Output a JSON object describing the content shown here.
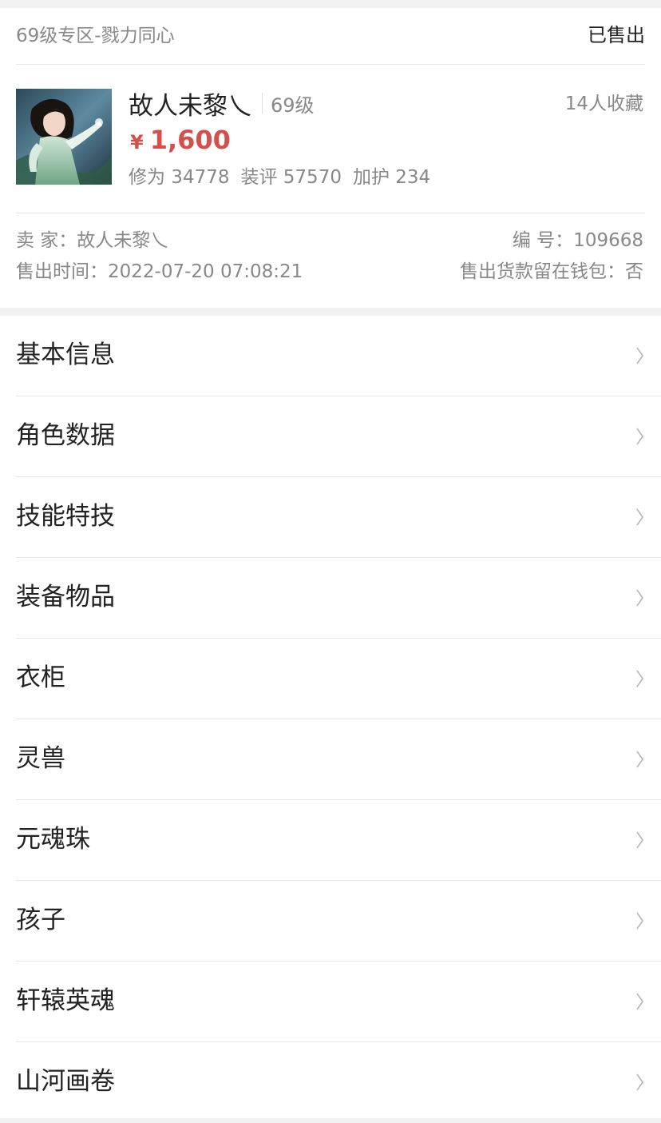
{
  "header": {
    "zone": "69级专区-戮力同心",
    "status": "已售出"
  },
  "role": {
    "name": "故人未黎乀",
    "level": "69级",
    "favorites": "14人收藏",
    "currency_symbol": "¥",
    "price": "1,600",
    "stats": {
      "cultivation": "修为 34778",
      "equip_score": "装评 57570",
      "protection": "加护 234"
    }
  },
  "meta": {
    "seller": "卖  家：故人未黎乀",
    "serial": "编  号：109668",
    "sold_time": "售出时间：2022-07-20 07:08:21",
    "wallet": "售出货款留在钱包：否"
  },
  "menu": {
    "items": [
      {
        "label": "基本信息"
      },
      {
        "label": "角色数据"
      },
      {
        "label": "技能特技"
      },
      {
        "label": "装备物品"
      },
      {
        "label": "衣柜"
      },
      {
        "label": "灵兽"
      },
      {
        "label": "元魂珠"
      },
      {
        "label": "孩子"
      },
      {
        "label": "轩辕英魂"
      },
      {
        "label": "山河画卷"
      }
    ]
  },
  "icons": {
    "menu_arrow": "chevron-right-icon",
    "avatar": "character-portrait"
  },
  "colors": {
    "price": "#d4504a",
    "secondary_text": "#888888",
    "background": "#f2f2f2"
  }
}
